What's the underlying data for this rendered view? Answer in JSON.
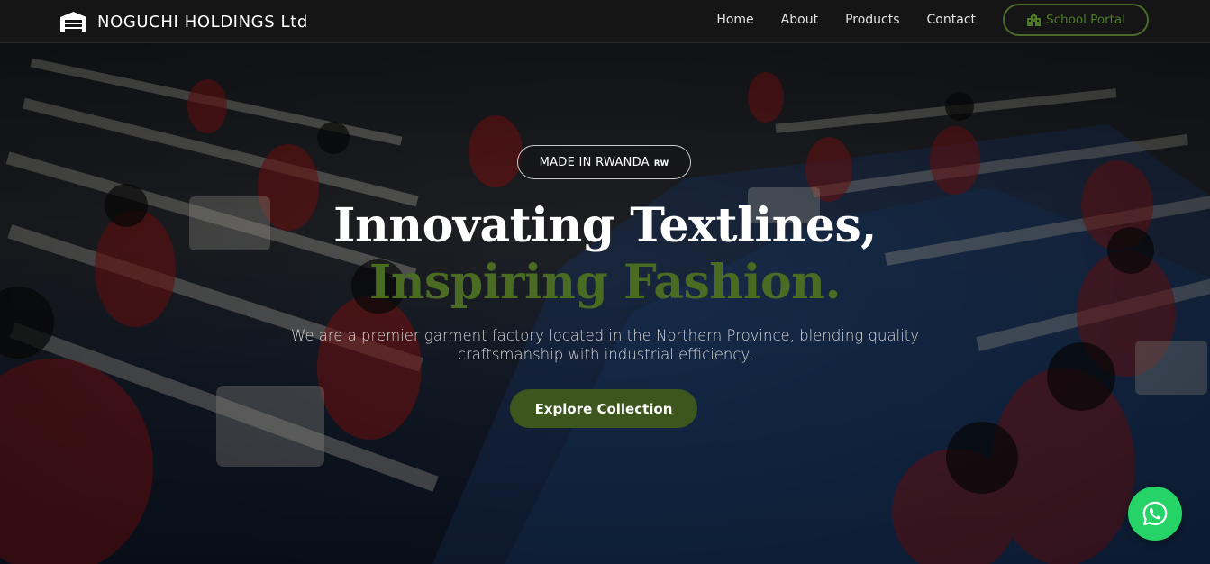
{
  "brand": {
    "name": "NOGUCHI HOLDINGS Ltd",
    "icon": "warehouse-icon"
  },
  "nav": {
    "links": [
      {
        "label": "Home"
      },
      {
        "label": "About"
      },
      {
        "label": "Products"
      },
      {
        "label": "Contact"
      }
    ],
    "portal": {
      "label": "School Portal",
      "icon": "school-icon"
    }
  },
  "hero": {
    "badge": {
      "text": "MADE IN RWANDA",
      "flag": "RW"
    },
    "headline_line1": "Innovating Textlines,",
    "headline_line2": "Inspiring Fashion.",
    "subtitle": "We are a premier garment factory located in the Northern Province, blending quality craftsmanship with industrial efficiency.",
    "cta_label": "Explore Collection"
  },
  "floating": {
    "whatsapp_icon": "whatsapp-icon"
  },
  "colors": {
    "navbar_bg": "#151515",
    "accent_green": "#4a6b22",
    "cta_bg": "#3d561d",
    "whatsapp_green": "#25d366"
  }
}
